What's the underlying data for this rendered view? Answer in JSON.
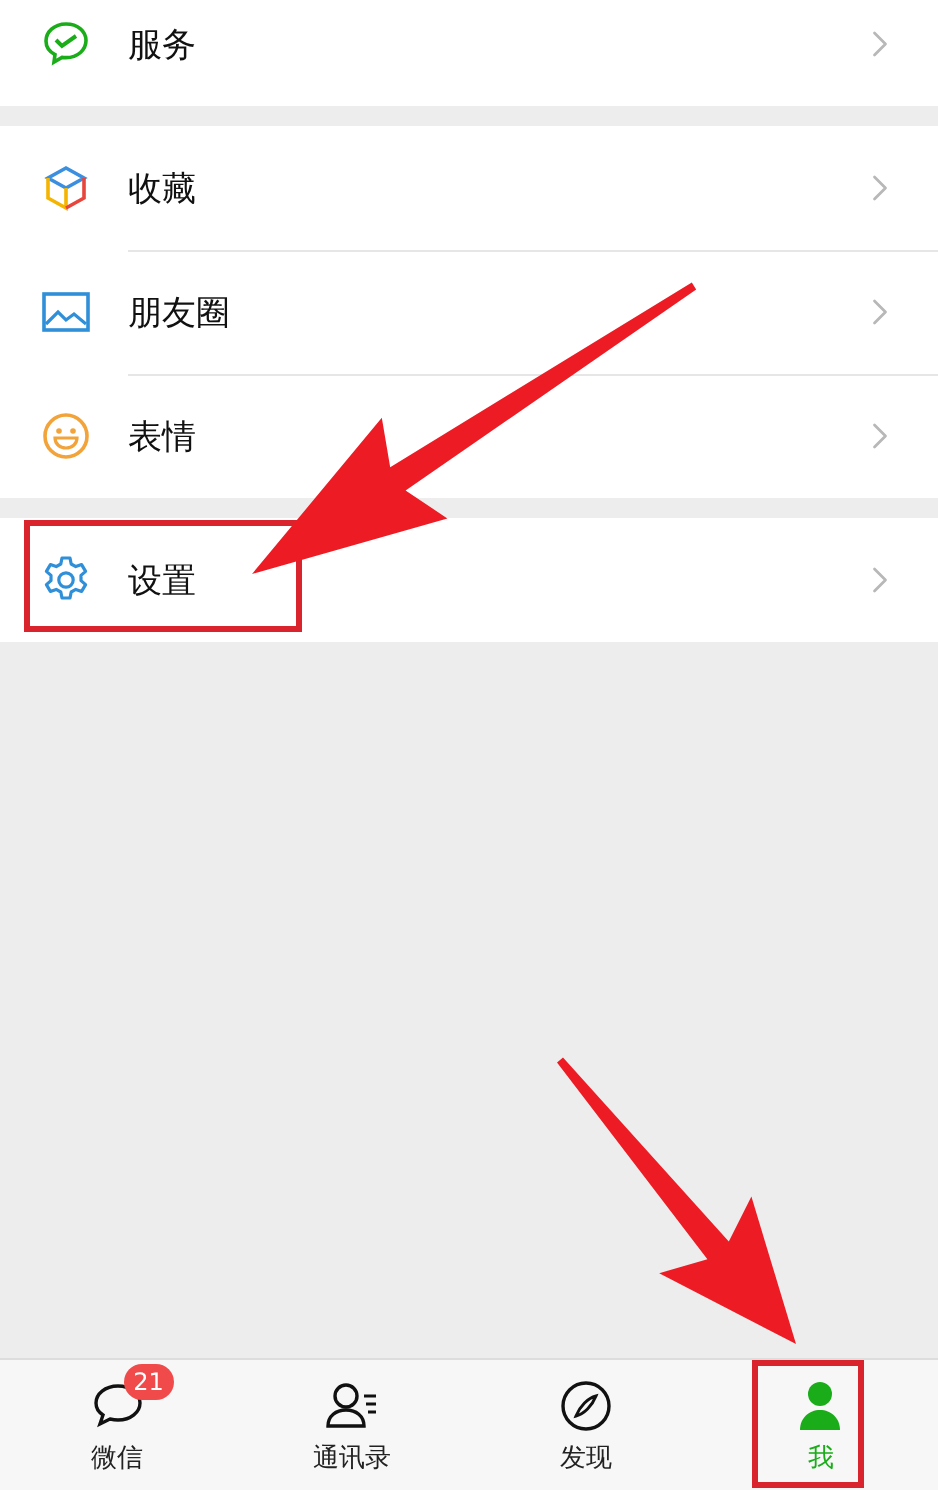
{
  "menu_groups": [
    {
      "items": [
        {
          "label": "服务",
          "kind": "service",
          "highlighted": false
        }
      ]
    },
    {
      "items": [
        {
          "label": "收藏",
          "kind": "favorites",
          "highlighted": false
        },
        {
          "label": "朋友圈",
          "kind": "moments",
          "highlighted": false
        },
        {
          "label": "表情",
          "kind": "stickers",
          "highlighted": false
        }
      ]
    },
    {
      "items": [
        {
          "label": "设置",
          "kind": "settings",
          "highlighted": true
        }
      ]
    }
  ],
  "tab_bar": [
    {
      "label": "微信",
      "kind": "chats",
      "badge": "21",
      "selected": false,
      "highlighted": false
    },
    {
      "label": "通讯录",
      "kind": "contacts",
      "selected": false,
      "highlighted": false
    },
    {
      "label": "发现",
      "kind": "discover",
      "selected": false,
      "highlighted": false
    },
    {
      "label": "我",
      "kind": "me",
      "selected": true,
      "highlighted": true
    }
  ]
}
